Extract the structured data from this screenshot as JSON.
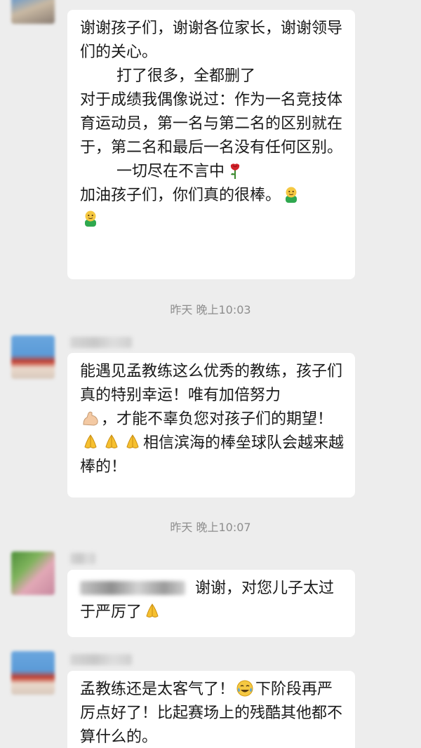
{
  "messages": [
    {
      "lines": [
        "谢谢孩子们，谢谢各位家长，谢谢领导们的关心。",
        "打了很多，全都删了",
        "对于成绩我偶像说过：作为一名竞技体育运动员，第一名与第二名的区别就在于，第二名和最后一名没有任何区别。",
        "一切尽在不言中",
        "加油孩子们，你们真的很棒。"
      ],
      "emojis": [
        "rose-emoji",
        "fist-emoji",
        "fist-emoji"
      ]
    },
    {
      "timestamp": "昨天 晚上10:03"
    },
    {
      "lines": [
        "能遇见孟教练这么优秀的教练，孩子们真的特别幸运！唯有加倍努力",
        "，才能不辜负您对孩子们的期望！",
        "相信滨海的棒垒球队会越来越棒的！"
      ],
      "emojis": [
        "muscle-emoji",
        "pray-emoji",
        "pray-emoji",
        "pray-emoji"
      ]
    },
    {
      "timestamp": "昨天 晚上10:07"
    },
    {
      "lines": [
        "谢谢，对您儿子太过于严厉了"
      ],
      "emojis": [
        "pray-emoji"
      ]
    },
    {
      "lines": [
        "孟教练还是太客气了！",
        "下阶段再严厉点好了！比起赛场上的残酷其他都不算什么的。"
      ],
      "emojis": [
        "crying-laughing-emoji"
      ]
    }
  ],
  "colors": {
    "background": "#ededed",
    "bubble": "#ffffff",
    "text": "#1a1a1a",
    "timestamp": "#8e8e8e"
  }
}
